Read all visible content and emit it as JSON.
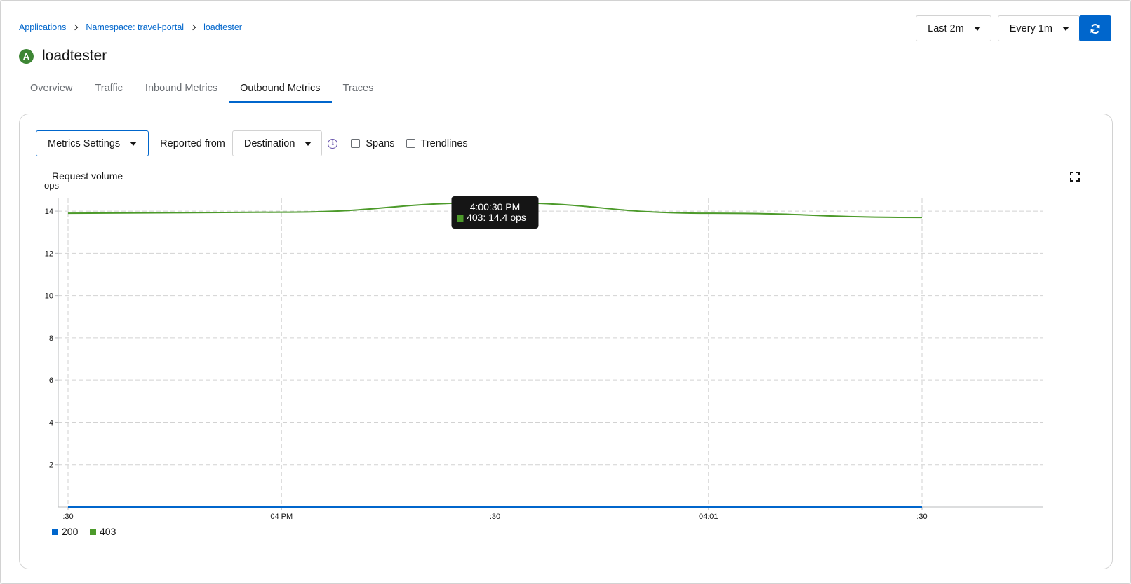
{
  "breadcrumb": [
    "Applications",
    "Namespace: travel-portal",
    "loadtester"
  ],
  "app": {
    "badge": "A",
    "title": "loadtester"
  },
  "controls": {
    "duration": "Last 2m",
    "refresh_interval": "Every 1m"
  },
  "tabs": [
    "Overview",
    "Traffic",
    "Inbound Metrics",
    "Outbound Metrics",
    "Traces"
  ],
  "active_tab": "Outbound Metrics",
  "toolbar": {
    "metrics_settings": "Metrics Settings",
    "reported_from_label": "Reported from",
    "reported_from_value": "Destination",
    "spans_label": "Spans",
    "trendlines_label": "Trendlines"
  },
  "colors": {
    "accent": "#0066cc",
    "series_200": "#0066cc",
    "series_403": "#4c9a2a",
    "badge": "#3e8635"
  },
  "icons": [
    "chevron-right-icon",
    "caret-down-icon",
    "sync-icon",
    "info-circle-icon",
    "expand-icon"
  ],
  "chart_data": {
    "type": "line",
    "title": "Request volume",
    "ylabel": "ops",
    "ylim": [
      0,
      14.6
    ],
    "yticks": [
      2,
      4,
      6,
      8,
      10,
      12,
      14
    ],
    "xticks": [
      ":30",
      "04 PM",
      ":30",
      "04:01",
      ":30"
    ],
    "series": [
      {
        "name": "200",
        "color": "#0066cc",
        "values": [
          0,
          0,
          0,
          0,
          0
        ]
      },
      {
        "name": "403",
        "color": "#4c9a2a",
        "values": [
          13.9,
          13.95,
          14.4,
          13.9,
          13.7
        ]
      }
    ],
    "legend": "bottom-left",
    "grid": true,
    "tooltip": {
      "time": "4:00:30 PM",
      "text": "403: 14.4 ops",
      "index": 2
    }
  }
}
